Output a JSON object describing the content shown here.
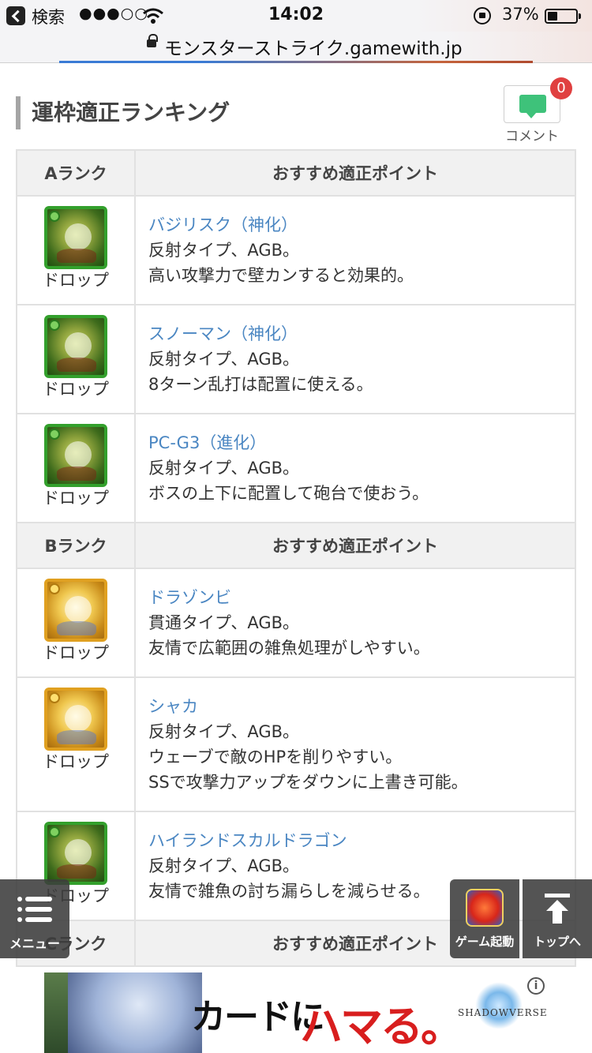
{
  "status_bar": {
    "carrier": "検索",
    "signal": "●●●○○",
    "time": "14:02",
    "battery_percent": "37%"
  },
  "url_bar": {
    "url": "モンスターストライク.gamewith.jp"
  },
  "heading": {
    "title": "運枠適正ランキング"
  },
  "comment": {
    "count": "0",
    "label": "コメント"
  },
  "table": {
    "point_header": "おすすめ適正ポイント",
    "sections": [
      {
        "rank": "Aランク",
        "rows": [
          {
            "icon_color": "green",
            "source": "ドロップ",
            "name": "バジリスク（神化）",
            "lines": [
              "反射タイプ、AGB。",
              "高い攻撃力で壁カンすると効果的。"
            ]
          },
          {
            "icon_color": "green",
            "source": "ドロップ",
            "name": "スノーマン（神化）",
            "lines": [
              "反射タイプ、AGB。",
              "8ターン乱打は配置に使える。"
            ]
          },
          {
            "icon_color": "green",
            "source": "ドロップ",
            "name": "PC-G3（進化）",
            "lines": [
              "反射タイプ、AGB。",
              "ボスの上下に配置して砲台で使おう。"
            ]
          }
        ]
      },
      {
        "rank": "Bランク",
        "rows": [
          {
            "icon_color": "gold",
            "source": "ドロップ",
            "name": "ドラゾンビ",
            "lines": [
              "貫通タイプ、AGB。",
              "友情で広範囲の雑魚処理がしやすい。"
            ]
          },
          {
            "icon_color": "gold",
            "source": "ドロップ",
            "name": "シャカ",
            "lines": [
              "反射タイプ、AGB。",
              "ウェーブで敵のHPを削りやすい。",
              "SSで攻撃力アップをダウンに上書き可能。"
            ]
          },
          {
            "icon_color": "green",
            "source": "ドロップ",
            "name": "ハイランドスカルドラゴン",
            "lines": [
              "反射タイプ、AGB。",
              "友情で雑魚の討ち漏らしを減らせる。"
            ]
          }
        ]
      },
      {
        "rank": "Cランク",
        "rows": []
      }
    ]
  },
  "floating": {
    "menu_label": "メニュー",
    "game_label": "ゲーム起動",
    "top_label": "トップへ"
  },
  "ad": {
    "copy_black": "カードに",
    "copy_red": "ハマる。",
    "brand": "SHADOWVERSE",
    "info": "i"
  }
}
